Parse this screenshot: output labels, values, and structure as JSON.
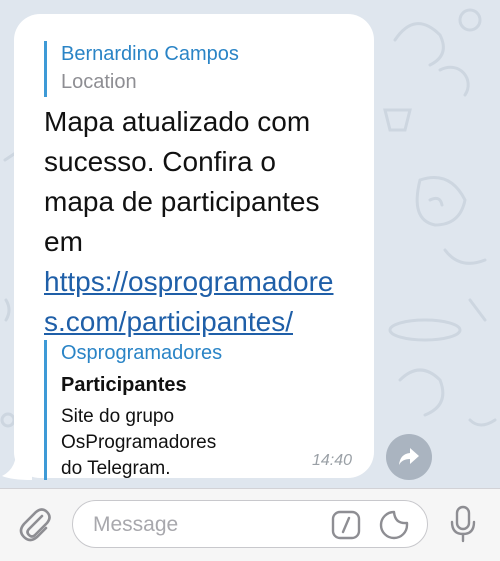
{
  "message": {
    "reply": {
      "name": "Bernardino Campos",
      "subtitle": "Location"
    },
    "text_lines": [
      "Mapa atualizado com",
      "sucesso. Confira o",
      "mapa de participantes",
      "em"
    ],
    "link_lines": [
      "https://osprogramadore",
      "s.com/participantes/"
    ],
    "preview": {
      "site": "Osprogramadores",
      "title": "Participantes",
      "description_lines": [
        "Site do grupo",
        "OsProgramadores",
        "do Telegram."
      ]
    },
    "time": "14:40",
    "share_icon": "share-arrow-icon"
  },
  "input": {
    "placeholder": "Message",
    "value": "",
    "icons": {
      "attach": "paperclip-icon",
      "command": "slash-command-icon",
      "sticker": "sticker-icon",
      "voice": "microphone-icon"
    }
  },
  "colors": {
    "chat_background": "#dfe6ee",
    "bubble": "#ffffff",
    "accent": "#3e9ad6",
    "link": "#1f5fa8",
    "meta": "#8e8e93"
  }
}
